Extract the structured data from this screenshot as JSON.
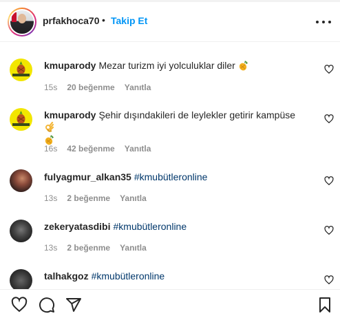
{
  "header": {
    "username": "prfakhoca70",
    "separator": "•",
    "follow_label": "Takip Et"
  },
  "comments": [
    {
      "username": "kmuparody",
      "text": "Mezar turizm iyi yolculuklar diler",
      "emoji_after": "pineapple",
      "time": "15s",
      "likes": "20 beğenme",
      "reply": "Yanıtla",
      "avatar": "yellow-pineapple-logo"
    },
    {
      "username": "kmuparody",
      "text": "Şehir dışındakileri de leylekler getirir kampüse",
      "emoji_after": "ok-hand + pineapple",
      "time": "16s",
      "likes": "42 beğenme",
      "reply": "Yanıtla",
      "avatar": "yellow-pineapple-logo"
    },
    {
      "username": "fulyagmur_alkan35",
      "text": "#kmubütleronline",
      "time": "13s",
      "likes": "2 beğenme",
      "reply": "Yanıtla",
      "avatar": "photo"
    },
    {
      "username": "zekeryatasdibi",
      "text": "#kmubütleronline",
      "time": "13s",
      "likes": "2 beğenme",
      "reply": "Yanıtla",
      "avatar": "photo"
    },
    {
      "username": "talhakgoz",
      "text": "#kmubütleronline",
      "avatar": "photo"
    }
  ],
  "actions": {
    "like": "heart-icon",
    "comment": "comment-icon",
    "share": "send-icon",
    "save": "bookmark-icon"
  },
  "colors": {
    "accent": "#0095f6",
    "hashtag": "#00376b",
    "meta": "#8e8e8e",
    "text": "#262626"
  }
}
